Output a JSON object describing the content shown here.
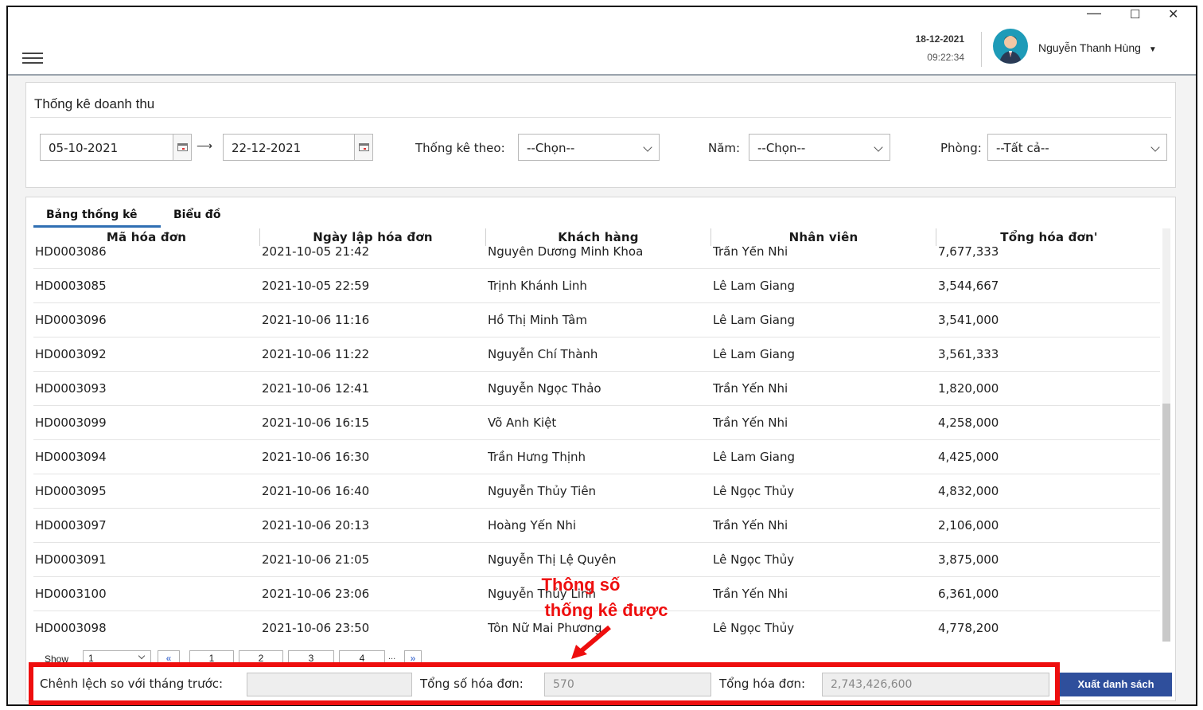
{
  "header": {
    "date": "18-12-2021",
    "time": "09:22:34",
    "user_name": "Nguyễn Thanh Hùng",
    "window_controls": [
      "—",
      "☐",
      "✕"
    ]
  },
  "filter": {
    "title": "Thống kê doanh thu",
    "date_from": "05-10-2021",
    "date_to": "22-12-2021",
    "stat_by_label": "Thống kê theo:",
    "stat_by_value": "--Chọn--",
    "year_label": "Năm:",
    "year_value": "--Chọn--",
    "room_label": "Phòng:",
    "room_value": "--Tất cả--"
  },
  "tabs": [
    "Bảng thống kê",
    "Biểu đồ"
  ],
  "table": {
    "columns": [
      "Mã hóa đơn",
      "Ngày lập hóa đơn",
      "Khách hàng",
      "Nhân viên",
      "Tổng hóa đơn'"
    ],
    "rows": [
      [
        "HD0003086",
        "2021-10-05 21:42",
        "Nguyễn Dương Minh Khoa",
        "Trần Yến Nhi",
        "7,677,333"
      ],
      [
        "HD0003085",
        "2021-10-05 22:59",
        "Trịnh Khánh Linh",
        "Lê Lam Giang",
        "3,544,667"
      ],
      [
        "HD0003096",
        "2021-10-06 11:16",
        "Hồ Thị Minh Tâm",
        "Lê Lam Giang",
        "3,541,000"
      ],
      [
        "HD0003092",
        "2021-10-06 11:22",
        "Nguyễn Chí Thành",
        "Lê Lam Giang",
        "3,561,333"
      ],
      [
        "HD0003093",
        "2021-10-06 12:41",
        "Nguyễn Ngọc Thảo",
        "Trần Yến Nhi",
        "1,820,000"
      ],
      [
        "HD0003099",
        "2021-10-06 16:15",
        "Võ Anh Kiệt",
        "Trần Yến Nhi",
        "4,258,000"
      ],
      [
        "HD0003094",
        "2021-10-06 16:30",
        "Trần Hưng Thịnh",
        "Lê Lam Giang",
        "4,425,000"
      ],
      [
        "HD0003095",
        "2021-10-06 16:40",
        "Nguyễn Thủy Tiên",
        "Lê Ngọc Thủy",
        "4,832,000"
      ],
      [
        "HD0003097",
        "2021-10-06 20:13",
        "Hoàng Yến Nhi",
        "Trần Yến Nhi",
        "2,106,000"
      ],
      [
        "HD0003091",
        "2021-10-06 21:05",
        "Nguyễn Thị Lệ Quyên",
        "Lê Ngọc Thủy",
        "3,875,000"
      ],
      [
        "HD0003100",
        "2021-10-06 23:06",
        "Nguyễn Thủy Linh",
        "Trần Yến Nhi",
        "6,361,000"
      ],
      [
        "HD0003098",
        "2021-10-06 23:50",
        "Tôn Nữ Mai Phương",
        "Lê Ngọc Thủy",
        "4,778,200"
      ]
    ]
  },
  "pagination": {
    "show_label": "Show",
    "page_size": "1",
    "first": "«",
    "pages": [
      "1",
      "2",
      "3",
      "4"
    ],
    "ellipsis": "...",
    "last": "»"
  },
  "summary": {
    "diff_label": "Chênh lệch so với  tháng trước:",
    "diff_value": "",
    "count_label": "Tổng số hóa đơn:",
    "count_value": "570",
    "total_label": "Tổng hóa đơn:",
    "total_value": "2,743,426,600",
    "export_label": "Xuất danh sách"
  },
  "annotation": {
    "line1": "Thông số",
    "line2": "thống kê được",
    "color": "#ee0e0e"
  },
  "colors": {
    "accent": "#2f4f9c",
    "tab_underline": "#2f6fb3",
    "avatar": "#1e9bb8"
  }
}
